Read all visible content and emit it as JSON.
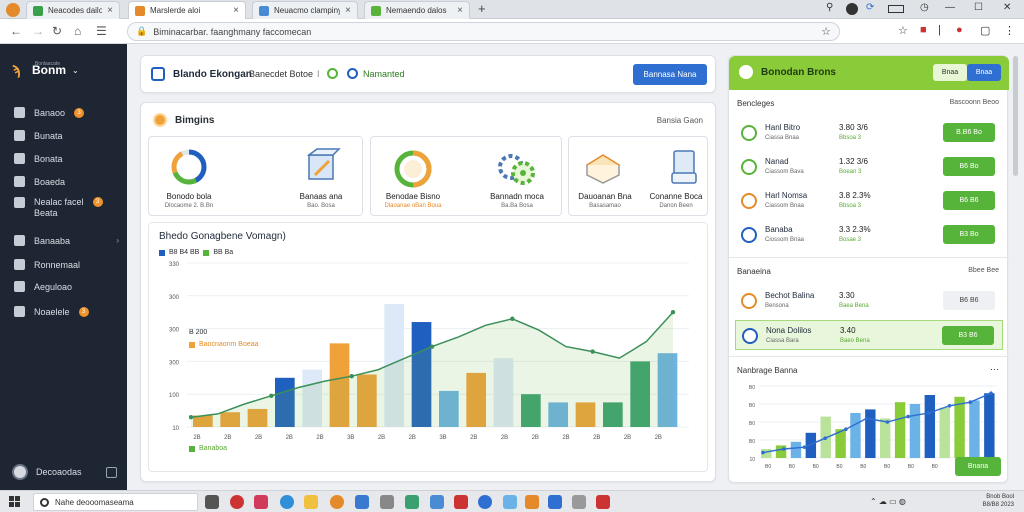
{
  "browser": {
    "tabs": [
      {
        "title": "Neacodes dailos",
        "color": "#3aa04a"
      },
      {
        "title": "Marslerde aloi",
        "color": "#e58a2a"
      },
      {
        "title": "Neuacmo clampinymatis",
        "color": "#4a8bd6"
      },
      {
        "title": "Nemaendo dalos",
        "color": "#58b33a"
      }
    ],
    "new_tab": "+",
    "url": "Biminacarbar. faanghmany faccomecan",
    "window_controls": [
      "—",
      "☐",
      "✕"
    ]
  },
  "sidebar": {
    "brand": "Bonm",
    "brand_sub": "Bonlaacate",
    "items": [
      {
        "label": "Banaoo",
        "badge": "3",
        "icon": "home-icon"
      },
      {
        "label": "Bunata",
        "badge": "",
        "icon": "grid-icon"
      },
      {
        "label": "Bonata",
        "badge": "",
        "icon": "chart-icon"
      },
      {
        "label": "Boaeda",
        "badge": "",
        "icon": "flag-icon"
      },
      {
        "label": "Nealac facel",
        "label2": "Beata",
        "badge": "3",
        "icon": "users-icon"
      },
      {
        "label": "Banaaba",
        "badge": "",
        "icon": "gear-icon",
        "chevron": true
      },
      {
        "label": "Ronnemaal",
        "badge": "",
        "icon": "mail-icon"
      },
      {
        "label": "Aeguloao",
        "badge": "",
        "icon": "folder-icon"
      },
      {
        "label": "Noaelele",
        "badge": "3",
        "icon": "settings-icon"
      }
    ],
    "footer": "Decoaodas"
  },
  "topbar": {
    "title": "Blando Ekongan",
    "subtitle": "Banecdet Botoe",
    "sep": "I",
    "link": "Namanted",
    "button": "Bannasa Nana"
  },
  "main": {
    "title": "Bimgins",
    "more": "Bansia Gaon",
    "cards": [
      {
        "label": "Bonodo bola",
        "sub": "Dlocaome 2. B.Bn"
      },
      {
        "label": "Banaas ana",
        "sub": "Bao. Bosa"
      },
      {
        "label": "Benodae Bisno",
        "sub": "Dlaoanae oBan Boua"
      },
      {
        "label": "Bannadn moca",
        "sub": "Ba.Ba Bosa"
      },
      {
        "label": "Dauoanan Bna",
        "sub": "Basasamao"
      },
      {
        "label": "Conanne Boca",
        "sub": "Danon Been"
      }
    ]
  },
  "chart_data": {
    "type": "bar",
    "title": "Bhedo Gonagbene Vomagn)",
    "legend": [
      {
        "name": "B8 B4 BB",
        "color": "#1f5fbf"
      },
      {
        "name": "BB Ba",
        "color": "#57b43a"
      },
      {
        "name": "Baocnaonm Boeaa",
        "color": "#f0a23a"
      }
    ],
    "annotation": "B 200",
    "footer_legend": "Banaboa",
    "yticks": [
      "330",
      "300",
      "300",
      "300",
      "100",
      "10"
    ],
    "categories": [
      "2B",
      "2B",
      "2B",
      "2B",
      "2B",
      "3B",
      "2B",
      "2B",
      "3B",
      "2B",
      "2B",
      "2B",
      "2B",
      "2B",
      "2B",
      "2B"
    ],
    "line": [
      12,
      16,
      28,
      38,
      48,
      56,
      62,
      70,
      84,
      98,
      110,
      124,
      132,
      118,
      98,
      92,
      84,
      104,
      140
    ],
    "bars": [
      {
        "value": 14,
        "color": "#f0a23a"
      },
      {
        "value": 18,
        "color": "#f0a23a"
      },
      {
        "value": 22,
        "color": "#f0a23a"
      },
      {
        "value": 60,
        "color": "#1f5fbf"
      },
      {
        "value": 70,
        "color": "#dde8f8"
      },
      {
        "value": 102,
        "color": "#f0a23a"
      },
      {
        "value": 64,
        "color": "#f0a23a"
      },
      {
        "value": 150,
        "color": "#dde8f8"
      },
      {
        "value": 128,
        "color": "#1f5fbf"
      },
      {
        "value": 44,
        "color": "#6bb2e6"
      },
      {
        "value": 66,
        "color": "#f0a23a"
      },
      {
        "value": 84,
        "color": "#dde8f8"
      },
      {
        "value": 40,
        "color": "#3aa070"
      },
      {
        "value": 30,
        "color": "#6bb2e6"
      },
      {
        "value": 30,
        "color": "#f0a23a"
      },
      {
        "value": 30,
        "color": "#3aa070"
      },
      {
        "value": 80,
        "color": "#3aa070"
      },
      {
        "value": 90,
        "color": "#6bb2e6"
      }
    ],
    "ylim": [
      0,
      200
    ],
    "grid": true,
    "legend_position": "top-left"
  },
  "right": {
    "title": "Bonodan Brons",
    "btn1": "Bnaa",
    "btn2": "Bnaa",
    "sec1": "Bencleges",
    "sec1_right": "Bascoonn Beoo",
    "rows": [
      {
        "name": "Hanl Bitro",
        "sub": "Ciassa Bnaa",
        "val": "3.80 3/6",
        "val2": "Bbsoa 3",
        "btn": "B.B6 Bo",
        "color": "#57b43a"
      },
      {
        "name": "Nanad",
        "sub": "Ciassom Bava",
        "val": "1.32 3/6",
        "val2": "Boean 3",
        "btn": "B6 Bo",
        "color": "#57b43a"
      },
      {
        "name": "Harl Nomsa",
        "sub": "Ciassom Bnaa",
        "val": "3.8 2.3%",
        "val2": "Bbsoa 3",
        "btn": "B6 B6",
        "color": "#e58a2a"
      },
      {
        "name": "Banaba",
        "sub": "Ciossom Bnaa",
        "val": "3.3 2.3%",
        "val2": "Bosae 3",
        "btn": "B3 Bo",
        "color": "#1f5fbf"
      }
    ],
    "sec2": "Banaeina",
    "sec2_right": "Bbee Bee",
    "rows2": [
      {
        "name": "Bechot Balina",
        "sub": "Bensona",
        "val": "3.30",
        "val2": "Baea Bena",
        "btn": "B6 B6",
        "light": true,
        "color": "#e58a2a"
      },
      {
        "name": "Nona Dolilos",
        "sub": "Ciassa Bara",
        "val": "3.40",
        "val2": "Baeo Bena",
        "btn": "B3 B6",
        "light": false,
        "color": "#57b43a"
      }
    ],
    "sec3": "Nanbrage Banna",
    "mini_yticks": [
      "B0",
      "B0",
      "B0",
      "B0",
      "10"
    ],
    "mini_xticks": [
      "B0",
      "B0",
      "B0",
      "B0",
      "B0",
      "B0",
      "B0",
      "B0",
      "B0",
      "B0"
    ],
    "mini_bars": [
      10,
      14,
      18,
      28,
      46,
      32,
      50,
      54,
      44,
      62,
      60,
      70,
      56,
      68,
      64,
      72
    ],
    "mini_line": [
      6,
      10,
      12,
      22,
      32,
      44,
      40,
      46,
      50,
      58,
      62,
      72
    ],
    "mini_button": "Bnana"
  },
  "taskbar": {
    "search": "Nahe deooomaseama",
    "time": "Bnob Bool",
    "date": "B8/B8 2023"
  }
}
